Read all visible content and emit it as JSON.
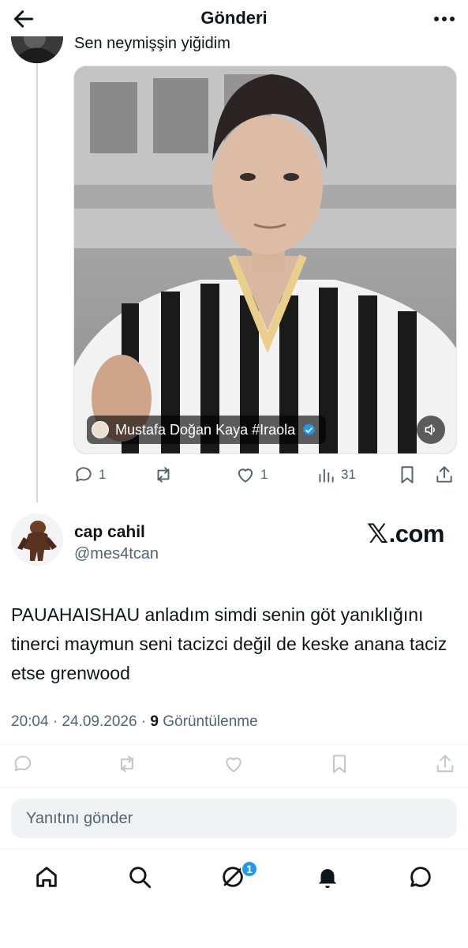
{
  "header": {
    "title": "Gönderi",
    "back_icon": "arrow-left-icon",
    "more_icon": "ellipsis-icon"
  },
  "parent_tweet": {
    "text_partial": "Sen neymişşin yiğidim",
    "media": {
      "overlay_tag": {
        "name": "Mustafa Doğan Kaya #Iraola",
        "verified": true
      },
      "mute_icon": "speaker-icon"
    },
    "actions": {
      "replies": "1",
      "reposts": "",
      "likes": "1",
      "views": "31"
    }
  },
  "quoted_tweet": {
    "display_name": "cap cahil",
    "handle": "@mes4tcan",
    "source_label": ".com",
    "source_mark": "𝕏",
    "body": "PAUAHAISHAU anladım simdi senin göt yanıklığını tinerci maymun seni tacizci değil de keske anana taciz etse grenwood",
    "time": "20:04 · 24.09.2026 · ",
    "views_count": "9",
    "views_label": " Görüntülenme"
  },
  "reply": {
    "placeholder": "Yanıtını gönder"
  },
  "tab_bar": {
    "items": [
      "home-icon",
      "search-icon",
      "grok-icon",
      "bell-icon",
      "messages-icon"
    ],
    "badge": "1"
  },
  "colors": {
    "accent": "#1d9bf0",
    "text": "#0f1419",
    "secondary": "#536471",
    "divider": "#eff3f4"
  }
}
